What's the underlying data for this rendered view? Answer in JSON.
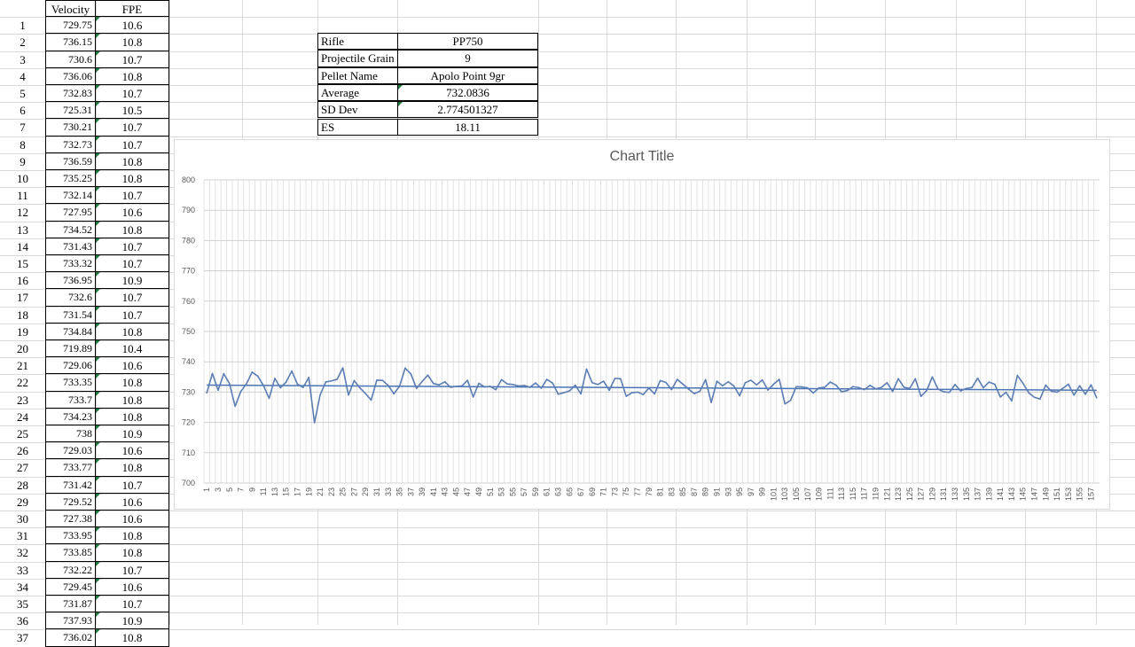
{
  "table": {
    "headers": {
      "velocity": "Velocity",
      "fpe": "FPE"
    },
    "rows": [
      {
        "n": "1",
        "v": "729.75",
        "f": "10.6"
      },
      {
        "n": "2",
        "v": "736.15",
        "f": "10.8"
      },
      {
        "n": "3",
        "v": "730.6",
        "f": "10.7"
      },
      {
        "n": "4",
        "v": "736.06",
        "f": "10.8"
      },
      {
        "n": "5",
        "v": "732.83",
        "f": "10.7"
      },
      {
        "n": "6",
        "v": "725.31",
        "f": "10.5"
      },
      {
        "n": "7",
        "v": "730.21",
        "f": "10.7"
      },
      {
        "n": "8",
        "v": "732.73",
        "f": "10.7"
      },
      {
        "n": "9",
        "v": "736.59",
        "f": "10.8"
      },
      {
        "n": "10",
        "v": "735.25",
        "f": "10.8"
      },
      {
        "n": "11",
        "v": "732.14",
        "f": "10.7"
      },
      {
        "n": "12",
        "v": "727.95",
        "f": "10.6"
      },
      {
        "n": "13",
        "v": "734.52",
        "f": "10.8"
      },
      {
        "n": "14",
        "v": "731.43",
        "f": "10.7"
      },
      {
        "n": "15",
        "v": "733.32",
        "f": "10.7"
      },
      {
        "n": "16",
        "v": "736.95",
        "f": "10.9"
      },
      {
        "n": "17",
        "v": "732.6",
        "f": "10.7"
      },
      {
        "n": "18",
        "v": "731.54",
        "f": "10.7"
      },
      {
        "n": "19",
        "v": "734.84",
        "f": "10.8"
      },
      {
        "n": "20",
        "v": "719.89",
        "f": "10.4"
      },
      {
        "n": "21",
        "v": "729.06",
        "f": "10.6"
      },
      {
        "n": "22",
        "v": "733.35",
        "f": "10.8"
      },
      {
        "n": "23",
        "v": "733.7",
        "f": "10.8"
      },
      {
        "n": "24",
        "v": "734.23",
        "f": "10.8"
      },
      {
        "n": "25",
        "v": "738",
        "f": "10.9"
      },
      {
        "n": "26",
        "v": "729.03",
        "f": "10.6"
      },
      {
        "n": "27",
        "v": "733.77",
        "f": "10.8"
      },
      {
        "n": "28",
        "v": "731.42",
        "f": "10.7"
      },
      {
        "n": "29",
        "v": "729.52",
        "f": "10.6"
      },
      {
        "n": "30",
        "v": "727.38",
        "f": "10.6"
      },
      {
        "n": "31",
        "v": "733.95",
        "f": "10.8"
      },
      {
        "n": "32",
        "v": "733.85",
        "f": "10.8"
      },
      {
        "n": "33",
        "v": "732.22",
        "f": "10.7"
      },
      {
        "n": "34",
        "v": "729.45",
        "f": "10.6"
      },
      {
        "n": "35",
        "v": "731.87",
        "f": "10.7"
      },
      {
        "n": "36",
        "v": "737.93",
        "f": "10.9"
      },
      {
        "n": "37",
        "v": "736.02",
        "f": "10.8"
      }
    ]
  },
  "info": [
    {
      "label": "Rifle",
      "value": "PP750"
    },
    {
      "label": "Projectile Grain",
      "value": "9"
    },
    {
      "label": "Pellet Name",
      "value": "Apolo Point 9gr"
    },
    {
      "label": "Average",
      "value": "732.0836"
    },
    {
      "label": "SD Dev",
      "value": "2.774501327"
    },
    {
      "label": "ES",
      "value": "18.11"
    }
  ],
  "colors": {
    "series": "#5b7db3",
    "trendline": "#4a74b5",
    "gridline": "#d9d9d9",
    "chart_title": "#595959",
    "error_indicator": "#1f7a3e"
  },
  "chart_data": {
    "type": "line",
    "title": "Chart Title",
    "xlabel": "",
    "ylabel": "",
    "ylim": [
      700,
      800
    ],
    "yticks": [
      700,
      710,
      720,
      730,
      740,
      750,
      760,
      770,
      780,
      790,
      800
    ],
    "x_tick_step": 2,
    "trendline": [
      732.3,
      730.6
    ],
    "grid": true,
    "legend": "none",
    "series": [
      {
        "values": [
          729.75,
          736.15,
          730.6,
          736.06,
          732.83,
          725.31,
          730.21,
          732.73,
          736.59,
          735.25,
          732.14,
          727.95,
          734.52,
          731.43,
          733.32,
          736.95,
          732.6,
          731.54,
          734.84,
          719.89,
          729.06,
          733.35,
          733.7,
          734.23,
          738.0,
          729.03,
          733.77,
          731.42,
          729.52,
          727.38,
          733.95,
          733.85,
          732.22,
          729.45,
          731.87,
          737.93,
          736.02,
          731.2,
          733.5,
          735.6,
          732.8,
          732.4,
          733.4,
          731.6,
          731.9,
          732.0,
          733.9,
          728.4,
          732.9,
          731.7,
          731.9,
          730.8,
          734.1,
          732.7,
          732.5,
          732.0,
          732.2,
          731.6,
          733.0,
          731.3,
          734.2,
          733.0,
          729.3,
          729.8,
          730.4,
          732.3,
          729.4,
          737.6,
          733.1,
          732.5,
          733.6,
          730.6,
          734.5,
          734.4,
          728.6,
          729.8,
          730.0,
          729.2,
          731.3,
          729.4,
          733.8,
          733.2,
          730.8,
          734.2,
          732.6,
          731.0,
          729.5,
          730.3,
          734.1,
          726.6,
          733.6,
          732.1,
          733.4,
          732.0,
          728.8,
          733.1,
          733.9,
          732.4,
          734.0,
          730.7,
          732.6,
          734.2,
          726.1,
          727.3,
          731.8,
          731.7,
          731.4,
          729.7,
          731.4,
          731.6,
          733.3,
          732.3,
          730.1,
          730.5,
          731.8,
          731.5,
          730.8,
          732.2,
          731.1,
          731.5,
          733.1,
          730.2,
          734.4,
          731.6,
          731.2,
          734.4,
          728.6,
          730.5,
          735.0,
          731.0,
          730.1,
          729.9,
          732.5,
          730.4,
          731.2,
          731.5,
          734.6,
          731.4,
          733.3,
          732.6,
          728.4,
          729.9,
          727.1,
          735.5,
          732.9,
          729.8,
          728.3,
          727.7,
          732.3,
          730.3,
          730.0,
          731.2,
          732.6,
          729.0,
          732.1,
          729.3,
          732.4,
          728.1
        ]
      }
    ]
  }
}
